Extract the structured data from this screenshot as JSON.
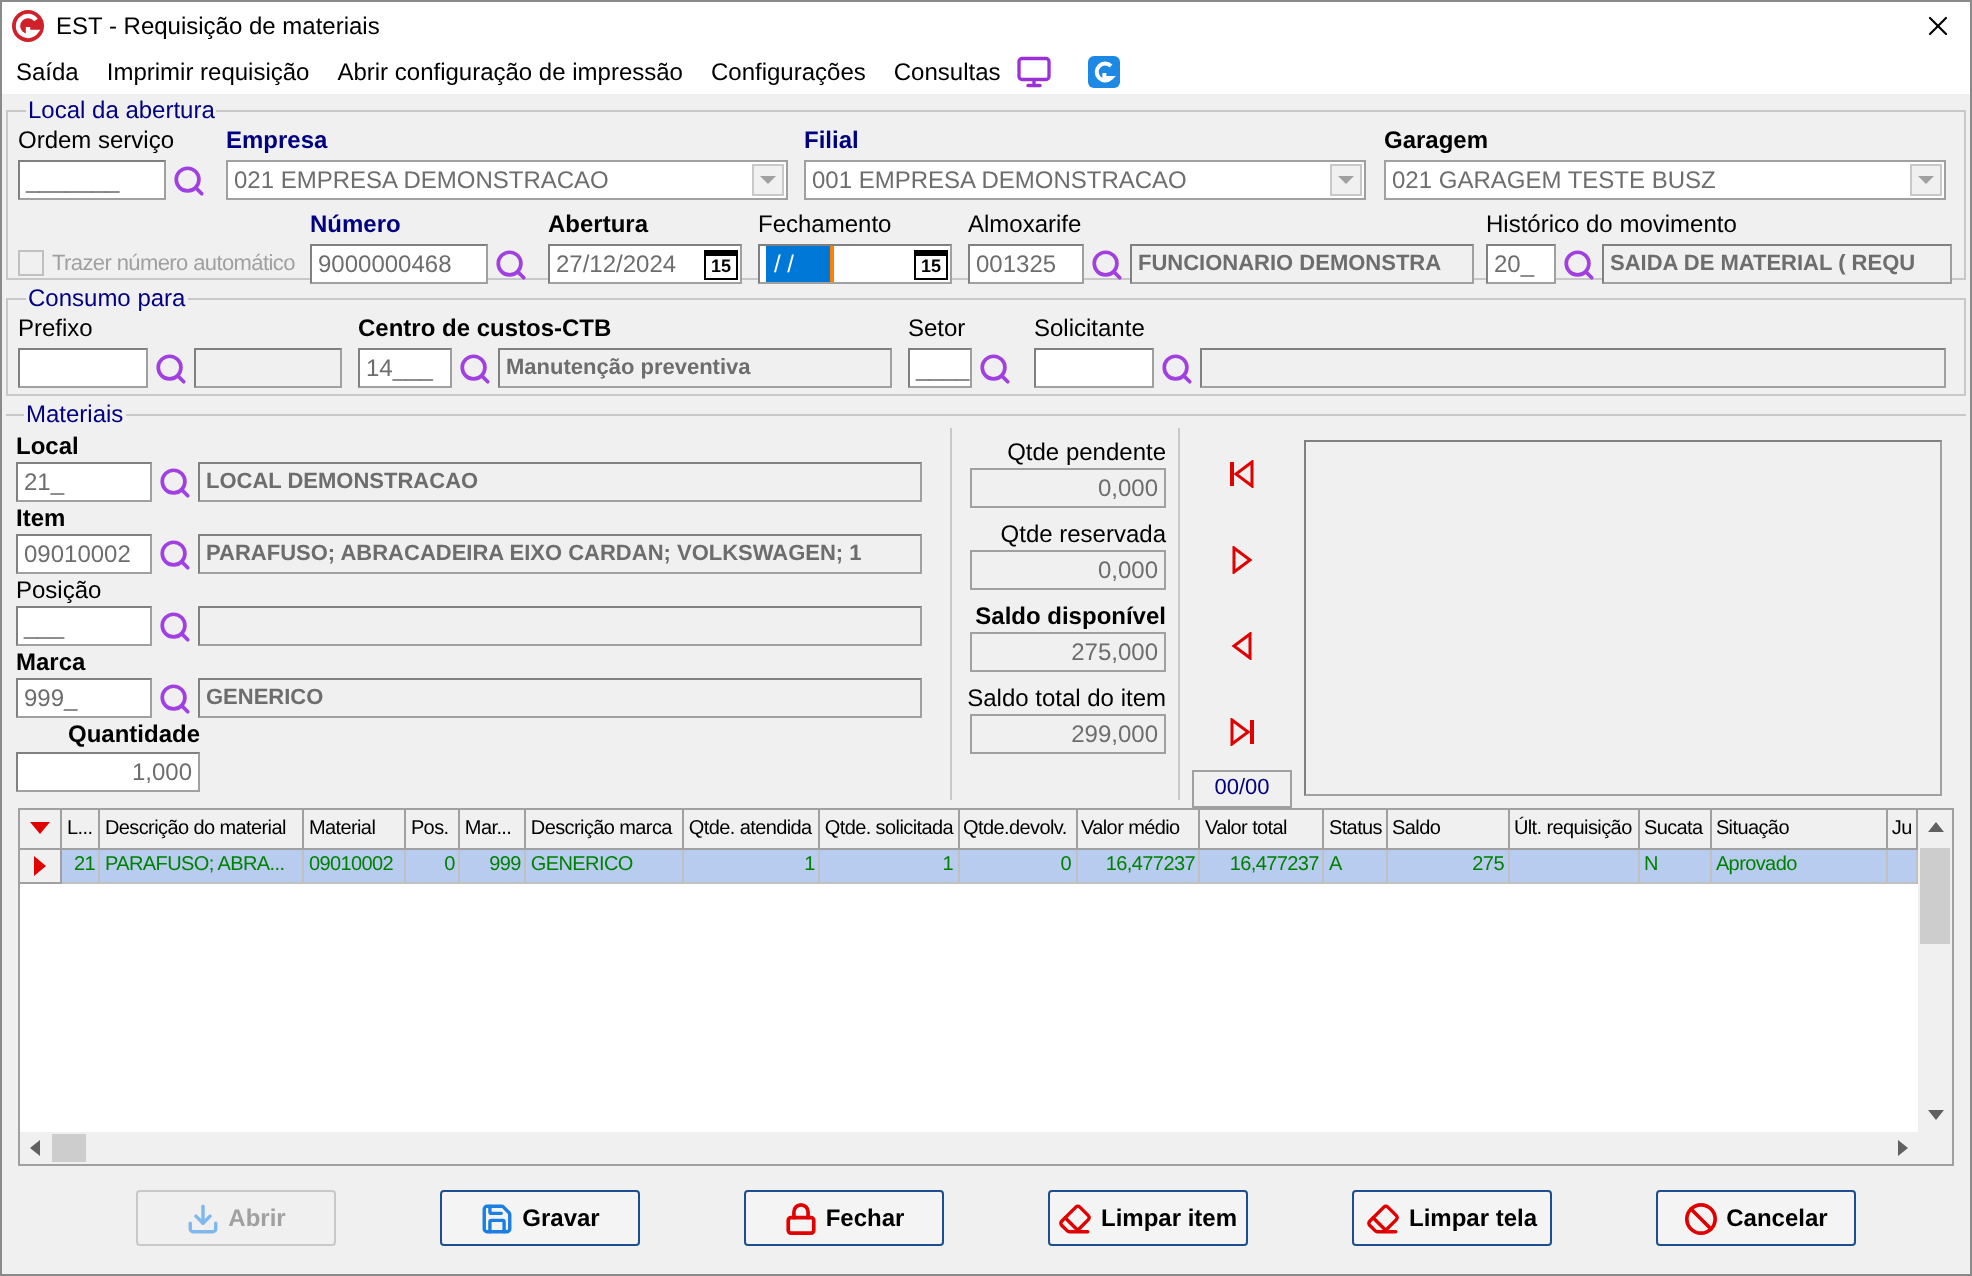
{
  "window": {
    "title": "EST - Requisição de materiais"
  },
  "menu": [
    {
      "label": "Saída"
    },
    {
      "label": "Imprimir requisição"
    },
    {
      "label": "Abrir configuração de impressão"
    },
    {
      "label": "Configurações"
    },
    {
      "label": "Consultas"
    }
  ],
  "local_abertura": {
    "title": "Local da abertura",
    "ordem_servico": {
      "label": "Ordem serviço",
      "value": "_______"
    },
    "empresa": {
      "label": "Empresa",
      "value": "021 EMPRESA DEMONSTRACAO"
    },
    "filial": {
      "label": "Filial",
      "value": "001 EMPRESA DEMONSTRACAO"
    },
    "garagem": {
      "label": "Garagem",
      "value": "021 GARAGEM TESTE BUSZ"
    },
    "trazer": {
      "label": "Trazer número automático",
      "checked": false,
      "disabled": true
    },
    "numero": {
      "label": "Número",
      "value": "9000000468"
    },
    "abertura": {
      "label": "Abertura",
      "value": "27/12/2024",
      "calendar": "15",
      "highlighted": false
    },
    "fechamento": {
      "label": "Fechamento",
      "value": "/ /",
      "calendar": "15",
      "highlighted": true
    },
    "almoxarife": {
      "label": "Almoxarife",
      "code": "001325",
      "description": "FUNCIONARIO DEMONSTRA"
    },
    "historico": {
      "label": "Histórico do movimento",
      "code": "20_",
      "description": "SAIDA DE MATERIAL ( REQU"
    }
  },
  "consumo": {
    "title": "Consumo para",
    "prefixo": {
      "label": "Prefixo"
    },
    "centro": {
      "label": "Centro de custos-CTB",
      "code": "14___",
      "description": "Manutenção preventiva"
    },
    "setor": {
      "label": "Setor",
      "code": "____"
    },
    "solicitante": {
      "label": "Solicitante"
    }
  },
  "materiais": {
    "title": "Materiais",
    "local": {
      "label": "Local",
      "code": "21_",
      "description": "LOCAL DEMONSTRACAO"
    },
    "item": {
      "label": "Item",
      "code": "09010002",
      "description": "PARAFUSO; ABRACADEIRA EIXO CARDAN; VOLKSWAGEN; 1"
    },
    "posicao": {
      "label": "Posição",
      "code": "___"
    },
    "marca": {
      "label": "Marca",
      "code": "999_",
      "description": "GENERICO"
    },
    "quantidade": {
      "label": "Quantidade",
      "value": "1,000"
    },
    "totals": [
      {
        "label": "Qtde pendente",
        "value": "0,000"
      },
      {
        "label": "Qtde reservada",
        "value": "0,000"
      },
      {
        "label": "Saldo disponível",
        "value": "275,000"
      },
      {
        "label": "Saldo total do item",
        "value": "299,000"
      }
    ],
    "counter": "00/00"
  },
  "table": {
    "columns": [
      {
        "label": "L..."
      },
      {
        "label": "Descrição do material"
      },
      {
        "label": "Material"
      },
      {
        "label": "Pos."
      },
      {
        "label": "Mar..."
      },
      {
        "label": "Descrição marca"
      },
      {
        "label": "Qtde. atendida"
      },
      {
        "label": "Qtde. solicitada"
      },
      {
        "label": "Qtde.devolv."
      },
      {
        "label": "Valor médio"
      },
      {
        "label": "Valor total"
      },
      {
        "label": "Status"
      },
      {
        "label": "Saldo"
      },
      {
        "label": "Últ. requisição"
      },
      {
        "label": "Sucata"
      },
      {
        "label": "Situação"
      },
      {
        "label": "Ju"
      }
    ],
    "rows": [
      {
        "selected": true,
        "cells": [
          "21",
          "PARAFUSO; ABRA...",
          "09010002",
          "0",
          "999",
          "GENERICO",
          "1",
          "1",
          "0",
          "16,477237",
          "16,477237",
          "A",
          "275",
          null,
          "N",
          "Aprovado"
        ]
      }
    ]
  },
  "buttons": [
    {
      "label": "Abrir",
      "kind": "open",
      "disabled": true
    },
    {
      "label": "Gravar",
      "kind": "save",
      "disabled": false
    },
    {
      "label": "Fechar",
      "kind": "close",
      "disabled": false
    },
    {
      "label": "Limpar item",
      "kind": "clear",
      "disabled": false
    },
    {
      "label": "Limpar tela",
      "kind": "clear",
      "disabled": false
    },
    {
      "label": "Cancelar",
      "kind": "cancel",
      "disabled": false
    }
  ]
}
